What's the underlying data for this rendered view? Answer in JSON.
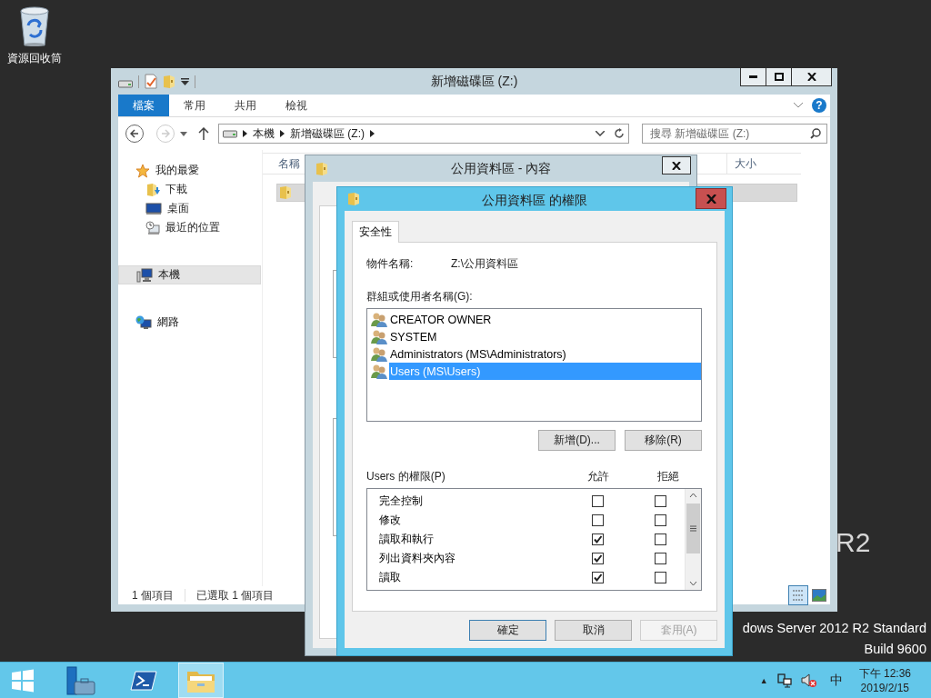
{
  "desktop": {
    "icons": [
      {
        "label": "資源回收筒"
      }
    ],
    "watermark": {
      "logo": "R2",
      "edition": "dows Server 2012 R2 Standard",
      "build": "Build 9600"
    }
  },
  "explorer": {
    "title": "新增磁碟區 (Z:)",
    "ribbon_tabs": [
      {
        "label": "檔案",
        "kind": "file",
        "selected": false
      },
      {
        "label": "常用",
        "kind": "tab",
        "selected": false
      },
      {
        "label": "共用",
        "kind": "tab",
        "selected": false
      },
      {
        "label": "檢視",
        "kind": "tab",
        "selected": false
      }
    ],
    "help": "?",
    "address": [
      "本機",
      "新增磁碟區 (Z:)"
    ],
    "search": {
      "placeholder": "搜尋 新增磁碟區 (Z:)"
    },
    "nav": [
      {
        "label": "我的最愛",
        "kind": "favorites",
        "selected": false,
        "children": [
          {
            "label": "下載",
            "kind": "downloads",
            "selected": false
          },
          {
            "label": "桌面",
            "kind": "desktop",
            "selected": false
          },
          {
            "label": "最近的位置",
            "kind": "recent",
            "selected": false
          }
        ]
      },
      {
        "label": "本機",
        "kind": "computer",
        "selected": true
      },
      {
        "label": "網路",
        "kind": "network",
        "selected": false
      }
    ],
    "columns": [
      "名稱",
      "大小"
    ],
    "files": [
      {
        "selected": true
      }
    ],
    "status": [
      "1 個項目",
      "已選取 1 個項目"
    ]
  },
  "properties_dialog": {
    "title": "公用資料區 - 內容"
  },
  "permissions_dialog": {
    "title": "公用資料區 的權限",
    "tabs": [
      {
        "label": "安全性",
        "selected": true
      }
    ],
    "object_label": "物件名稱:",
    "object_value": "Z:\\公用資料區",
    "groups_label": "群組或使用者名稱(G):",
    "groups": [
      {
        "name": "CREATOR OWNER",
        "selected": false
      },
      {
        "name": "SYSTEM",
        "selected": false
      },
      {
        "name": "Administrators (MS\\Administrators)",
        "selected": false
      },
      {
        "name": "Users (MS\\Users)",
        "selected": true
      }
    ],
    "group_buttons": [
      "新增(D)...",
      "移除(R)"
    ],
    "permissions_label": "Users 的權限(P)",
    "allow_header": "允許",
    "deny_header": "拒絕",
    "permissions": [
      {
        "name": "完全控制",
        "allow": false,
        "deny": false
      },
      {
        "name": "修改",
        "allow": false,
        "deny": false
      },
      {
        "name": "讀取和執行",
        "allow": true,
        "deny": false
      },
      {
        "name": "列出資料夾內容",
        "allow": true,
        "deny": false
      },
      {
        "name": "讀取",
        "allow": true,
        "deny": false
      }
    ],
    "buttons": [
      {
        "label": "確定",
        "disabled": false,
        "default": true
      },
      {
        "label": "取消",
        "disabled": false,
        "default": false
      },
      {
        "label": "套用(A)",
        "disabled": true,
        "default": false
      }
    ]
  },
  "taskbar": {
    "apps": [
      {
        "kind": "start",
        "selected": false
      },
      {
        "kind": "server-manager",
        "selected": false
      },
      {
        "kind": "powershell",
        "selected": false
      },
      {
        "kind": "explorer",
        "selected": true
      }
    ],
    "tray": {
      "arrow": "▲",
      "ime": "中",
      "time": "下午 12:36",
      "date": "2019/2/15"
    }
  }
}
